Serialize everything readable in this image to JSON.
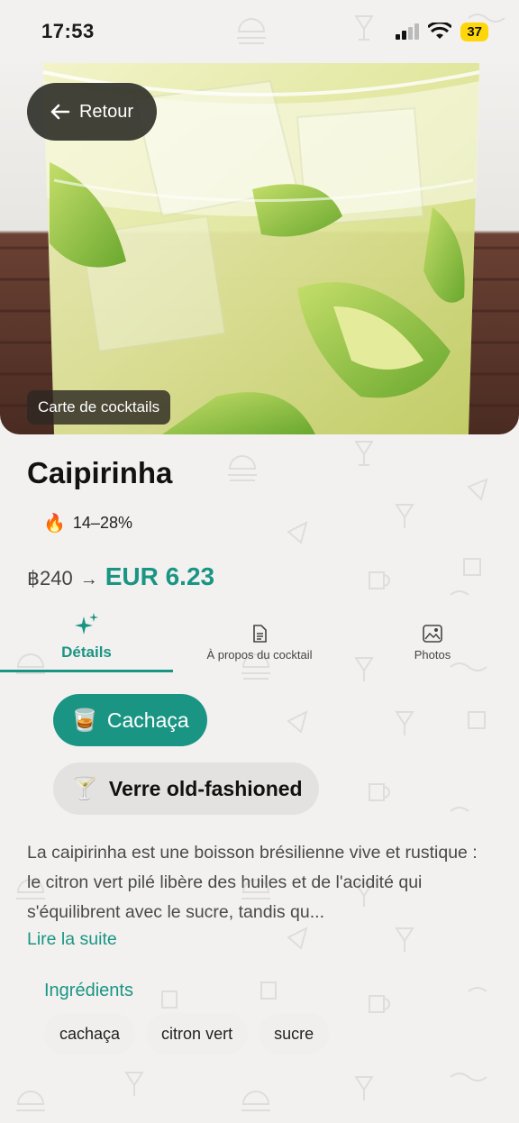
{
  "status_bar": {
    "time": "17:53",
    "battery": "37"
  },
  "hero": {
    "back_label": "Retour",
    "tag": "Carte de cocktails"
  },
  "drink": {
    "name": "Caipirinha",
    "abv": "14–28%",
    "price_original": "฿240",
    "price_arrow": "→",
    "price_converted": "EUR 6.23"
  },
  "tabs": [
    {
      "label": "Détails",
      "icon": "sparkles-icon",
      "active": true
    },
    {
      "label": "À propos du cocktail",
      "icon": "document-icon",
      "active": false
    },
    {
      "label": "Photos",
      "icon": "photos-icon",
      "active": false
    }
  ],
  "chips": {
    "spirit": {
      "emoji": "🥃",
      "label": "Cachaça"
    },
    "glass": {
      "emoji": "🍸",
      "label": "Verre old-fashioned"
    }
  },
  "description": "La caipirinha est une boisson brésilienne vive et rustique : le citron vert pilé libère des huiles et de l'acidité qui s'équilibrent avec le sucre, tandis qu...",
  "read_more": "Lire la suite",
  "ingredients": {
    "title": "Ingrédients",
    "items": [
      "cachaça",
      "citron vert",
      "sucre"
    ]
  },
  "colors": {
    "accent": "#1a9583",
    "back_button": "#2d2b24",
    "battery": "#ffd60a"
  }
}
